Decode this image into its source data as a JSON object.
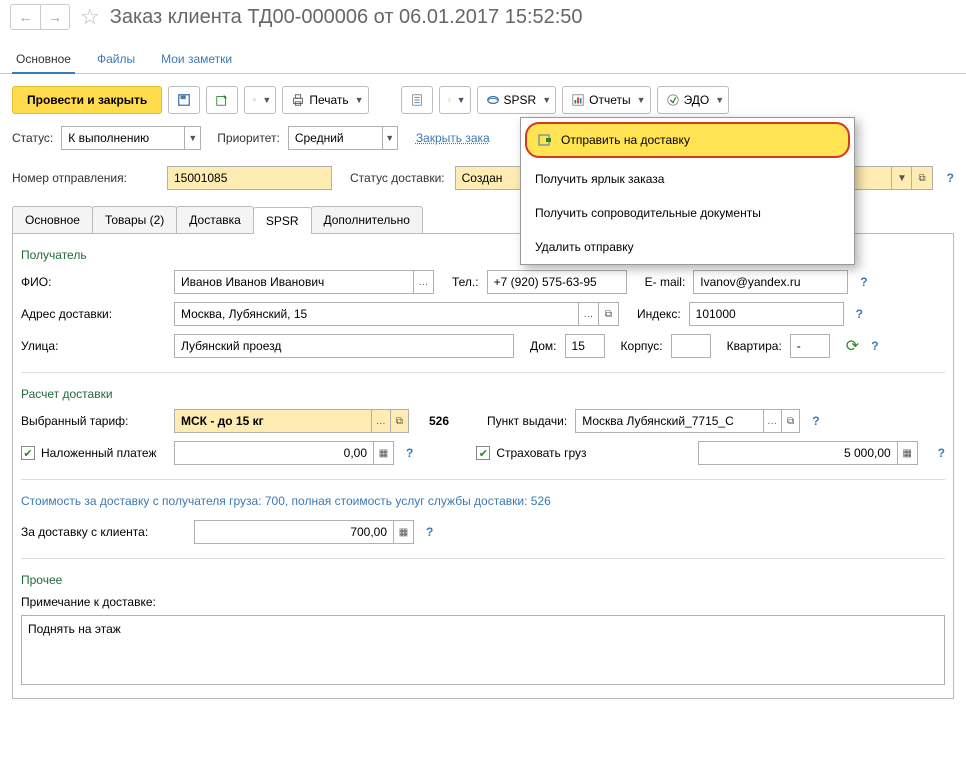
{
  "header": {
    "title": "Заказ клиента ТД00-000006 от 06.01.2017 15:52:50"
  },
  "top_tabs": {
    "main": "Основное",
    "files": "Файлы",
    "notes": "Мои заметки"
  },
  "toolbar": {
    "save_close": "Провести и закрыть",
    "print": "Печать",
    "spsr": "SPSR",
    "reports": "Отчеты",
    "edo": "ЭДО"
  },
  "status_row": {
    "status_label": "Статус:",
    "status_value": "К выполнению",
    "priority_label": "Приоритет:",
    "priority_value": "Средний",
    "close_order": "Закрыть зака"
  },
  "shipment": {
    "number_label": "Номер отправления:",
    "number_value": "15001085",
    "status_label": "Статус доставки:",
    "status_value": "Создан"
  },
  "dropdown": {
    "send": "Отправить на доставку",
    "label": "Получить ярлык заказа",
    "docs": "Получить сопроводительные документы",
    "delete": "Удалить отправку"
  },
  "form_tabs": {
    "main": "Основное",
    "goods": "Товары (2)",
    "delivery": "Доставка",
    "spsr": "SPSR",
    "additional": "Дополнительно"
  },
  "recipient": {
    "section": "Получатель",
    "fio_label": "ФИО:",
    "fio_value": "Иванов Иванов Иванович",
    "phone_label": "Тел.:",
    "phone_value": "+7 (920) 575-63-95",
    "email_label": "E- mail:",
    "email_value": "Ivanov@yandex.ru",
    "addr_label": "Адрес доставки:",
    "addr_value": "Москва, Лубянский, 15",
    "index_label": "Индекс:",
    "index_value": "101000",
    "street_label": "Улица:",
    "street_value": "Лубянский проезд",
    "house_label": "Дом:",
    "house_value": "15",
    "korpus_label": "Корпус:",
    "korpus_value": "",
    "flat_label": "Квартира:",
    "flat_value": "-"
  },
  "calc": {
    "section": "Расчет доставки",
    "tariff_label": "Выбранный тариф:",
    "tariff_value": "МСК - до 15 кг",
    "tariff_cost": "526",
    "pickup_label": "Пункт выдачи:",
    "pickup_value": "Москва Лубянский_7715_С",
    "cod_label": "Наложенный платеж",
    "cod_value": "0,00",
    "insure_label": "Страховать груз",
    "insure_value": "5 000,00"
  },
  "cost": {
    "line": "Стоимость за доставку с получателя груза: 700, полная стоимость услуг службы доставки: 526",
    "client_label": "За доставку с клиента:",
    "client_value": "700,00"
  },
  "other": {
    "section": "Прочее",
    "note_label": "Примечание к доставке:",
    "note_value": "Поднять на этаж"
  }
}
